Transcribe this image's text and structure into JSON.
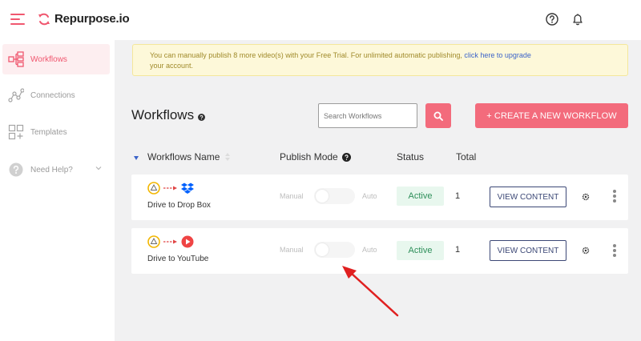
{
  "app": {
    "name": "Repurpose.io"
  },
  "colors": {
    "accent": "#f36b7c",
    "status_active_bg": "#e8f7ee",
    "status_active_text": "#2e8f5a",
    "arrow": "#e02020"
  },
  "header": {
    "icons": [
      "help-icon",
      "bell-icon"
    ]
  },
  "sidebar": {
    "items": [
      {
        "label": "Workflows",
        "icon": "workflows-icon",
        "active": true
      },
      {
        "label": "Connections",
        "icon": "connections-icon",
        "active": false
      },
      {
        "label": "Templates",
        "icon": "templates-icon",
        "active": false
      },
      {
        "label": "Need Help?",
        "icon": "help-circle-icon",
        "active": false
      }
    ]
  },
  "banner": {
    "text": "You can manually publish 8 more video(s) with your Free Trial. For unlimited automatic publishing, ",
    "link_text": "click here to upgrade",
    "text_line2": "your account."
  },
  "workflows": {
    "title": "Workflows",
    "search_placeholder": "Search Workflows",
    "create_button": "+ CREATE A NEW WORKFLOW",
    "columns": {
      "name": "Workflows Name",
      "publish_mode": "Publish Mode",
      "status": "Status",
      "total": "Total"
    },
    "rows": [
      {
        "name": "Drive to Drop Box",
        "source_icon": "google-drive-icon",
        "dest_icon": "dropbox-icon",
        "mode_manual": "Manual",
        "mode_auto": "Auto",
        "status": "Active",
        "total": "1",
        "view_button": "VIEW CONTENT"
      },
      {
        "name": "Drive to YouTube",
        "source_icon": "google-drive-icon",
        "dest_icon": "youtube-icon",
        "mode_manual": "Manual",
        "mode_auto": "Auto",
        "status": "Active",
        "total": "1",
        "view_button": "VIEW CONTENT"
      }
    ]
  }
}
